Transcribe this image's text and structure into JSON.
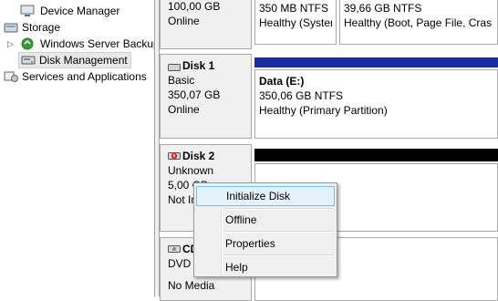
{
  "tree": {
    "items": [
      {
        "label": "Device Manager",
        "icon": "device-manager-icon"
      },
      {
        "label": "Storage",
        "icon": "storage-icon"
      },
      {
        "label": "Windows Server Backup",
        "icon": "backup-icon"
      },
      {
        "label": "Disk Management",
        "icon": "disk-management-icon",
        "selected": true
      },
      {
        "label": "Services and Applications",
        "icon": "services-icon"
      }
    ]
  },
  "disk0": {
    "size": "100,00 GB",
    "status": "Online",
    "volumes": [
      {
        "fs": "350 MB NTFS",
        "health": "Healthy (Syster"
      },
      {
        "fs": "39,66 GB NTFS",
        "health": "Healthy (Boot, Page File, Cras"
      }
    ]
  },
  "disk1": {
    "name": "Disk 1",
    "type": "Basic",
    "size": "350,07 GB",
    "status": "Online",
    "volume": {
      "name": "Data (E:)",
      "fs": "350,06 GB NTFS",
      "health": "Healthy (Primary Partition)"
    }
  },
  "disk2": {
    "name": "Disk 2",
    "type": "Unknown",
    "size": "5,00 GB",
    "status": "Not Initialized"
  },
  "cdrom": {
    "name": "CD-ROM 0",
    "type": "DVD (D:)",
    "status": "No Media"
  },
  "context_menu": {
    "items": [
      "Initialize Disk",
      "Offline",
      "Properties",
      "Help"
    ]
  },
  "colors": {
    "primary_bar": "#1a2ea3",
    "unallocated_bar": "#000000",
    "menu_highlight": "#e5f1fb"
  }
}
